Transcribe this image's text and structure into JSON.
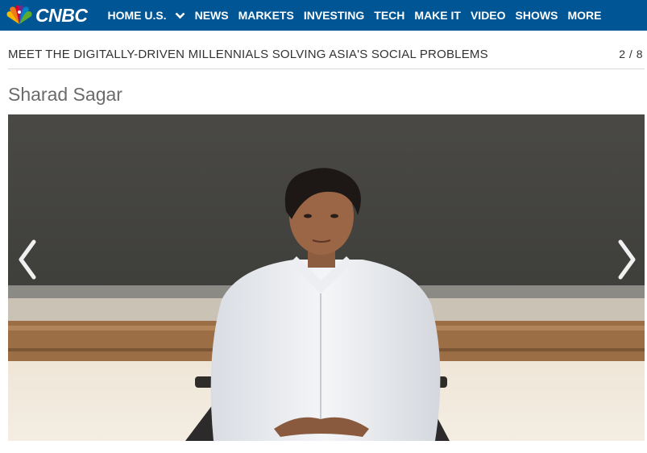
{
  "brand": {
    "name": "CNBC",
    "logo_icon": "nbc-peacock-icon"
  },
  "nav": {
    "items": [
      "HOME U.S.",
      "NEWS",
      "MARKETS",
      "INVESTING",
      "TECH",
      "MAKE IT",
      "VIDEO",
      "SHOWS",
      "MORE"
    ]
  },
  "slideshow": {
    "title": "MEET THE DIGITALLY-DRIVEN MILLENNIALS SOLVING ASIA'S SOCIAL PROBLEMS",
    "counter": "2 / 8",
    "slide_name": "Sharad Sagar",
    "image_description": "Young man in white shirt sitting in front of a chalkboard",
    "prev_icon": "chevron-left-icon",
    "next_icon": "chevron-right-icon"
  },
  "colors": {
    "nav_bg": "#005594",
    "nav_text": "#ffffff",
    "title_text": "#333333",
    "name_text": "#6b6b6b"
  }
}
